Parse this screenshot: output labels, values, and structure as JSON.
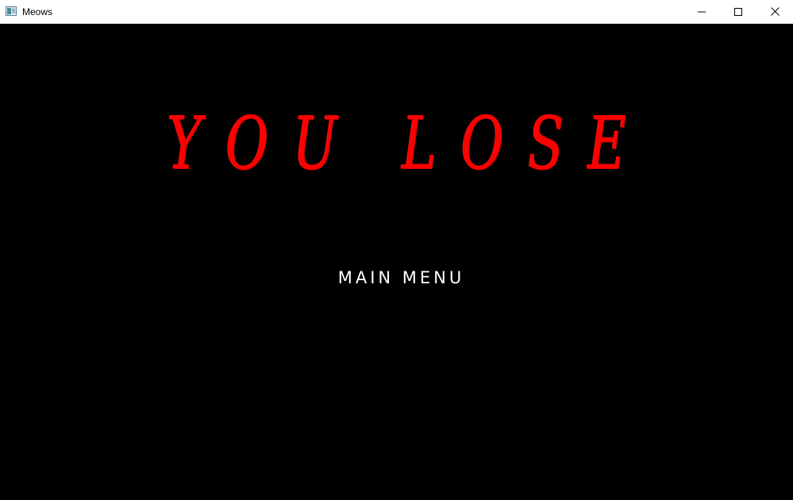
{
  "window": {
    "title": "Meows",
    "icon": "app-window-icon",
    "controls": {
      "minimize_icon": "minimize-icon",
      "maximize_icon": "maximize-icon",
      "close_icon": "close-icon"
    }
  },
  "game": {
    "headline": "YOU LOSE",
    "menu_option": "MAIN MENU"
  },
  "colors": {
    "background": "#000000",
    "headline": "#ff0000",
    "menu_text": "#ffffff",
    "titlebar": "#ffffff"
  }
}
